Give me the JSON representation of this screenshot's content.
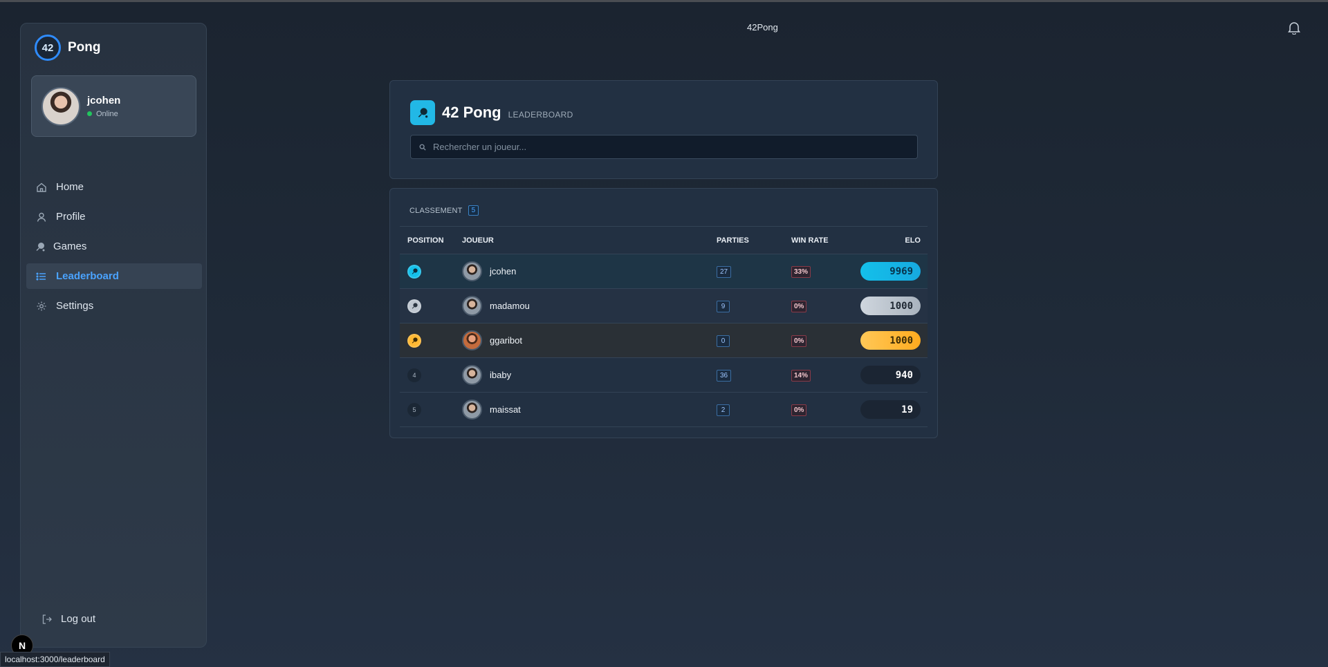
{
  "app": {
    "brand_badge": "42",
    "brand_name": "Pong",
    "header_title": "42Pong"
  },
  "user": {
    "name": "jcohen",
    "status": "Online"
  },
  "nav": {
    "items": [
      {
        "label": "Home",
        "icon": "home-icon"
      },
      {
        "label": "Profile",
        "icon": "user-icon"
      },
      {
        "label": "Games",
        "icon": "ping-pong-icon"
      },
      {
        "label": "Leaderboard",
        "icon": "list-icon",
        "active": true
      },
      {
        "label": "Settings",
        "icon": "gear-icon"
      }
    ],
    "logout": "Log out"
  },
  "leaderboard": {
    "title": "42 Pong",
    "subtitle": "LEADERBOARD",
    "search_placeholder": "Rechercher un joueur...",
    "section_label": "CLASSEMENT",
    "count": "5",
    "columns": {
      "position": "POSITION",
      "player": "JOUEUR",
      "games": "PARTIES",
      "win_rate": "WIN RATE",
      "elo": "ELO"
    },
    "rows": [
      {
        "rank": "1",
        "medal": "cyan",
        "name": "jcohen",
        "games": "27",
        "win_rate": "33%",
        "elo": "9969"
      },
      {
        "rank": "2",
        "medal": "silver",
        "name": "madamou",
        "games": "9",
        "win_rate": "0%",
        "elo": "1000"
      },
      {
        "rank": "3",
        "medal": "gold",
        "name": "ggaribot",
        "games": "0",
        "win_rate": "0%",
        "elo": "1000"
      },
      {
        "rank": "4",
        "medal": "none",
        "name": "ibaby",
        "games": "36",
        "win_rate": "14%",
        "elo": "940"
      },
      {
        "rank": "5",
        "medal": "none",
        "name": "maissat",
        "games": "2",
        "win_rate": "0%",
        "elo": "19"
      }
    ]
  },
  "colors": {
    "accent": "#4aa3ff",
    "cyan": "#14c0ea",
    "silver": "#bfc7d0",
    "gold": "#ffb833"
  },
  "status_bar": {
    "url": "localhost:3000/leaderboard",
    "dev_badge": "N"
  }
}
